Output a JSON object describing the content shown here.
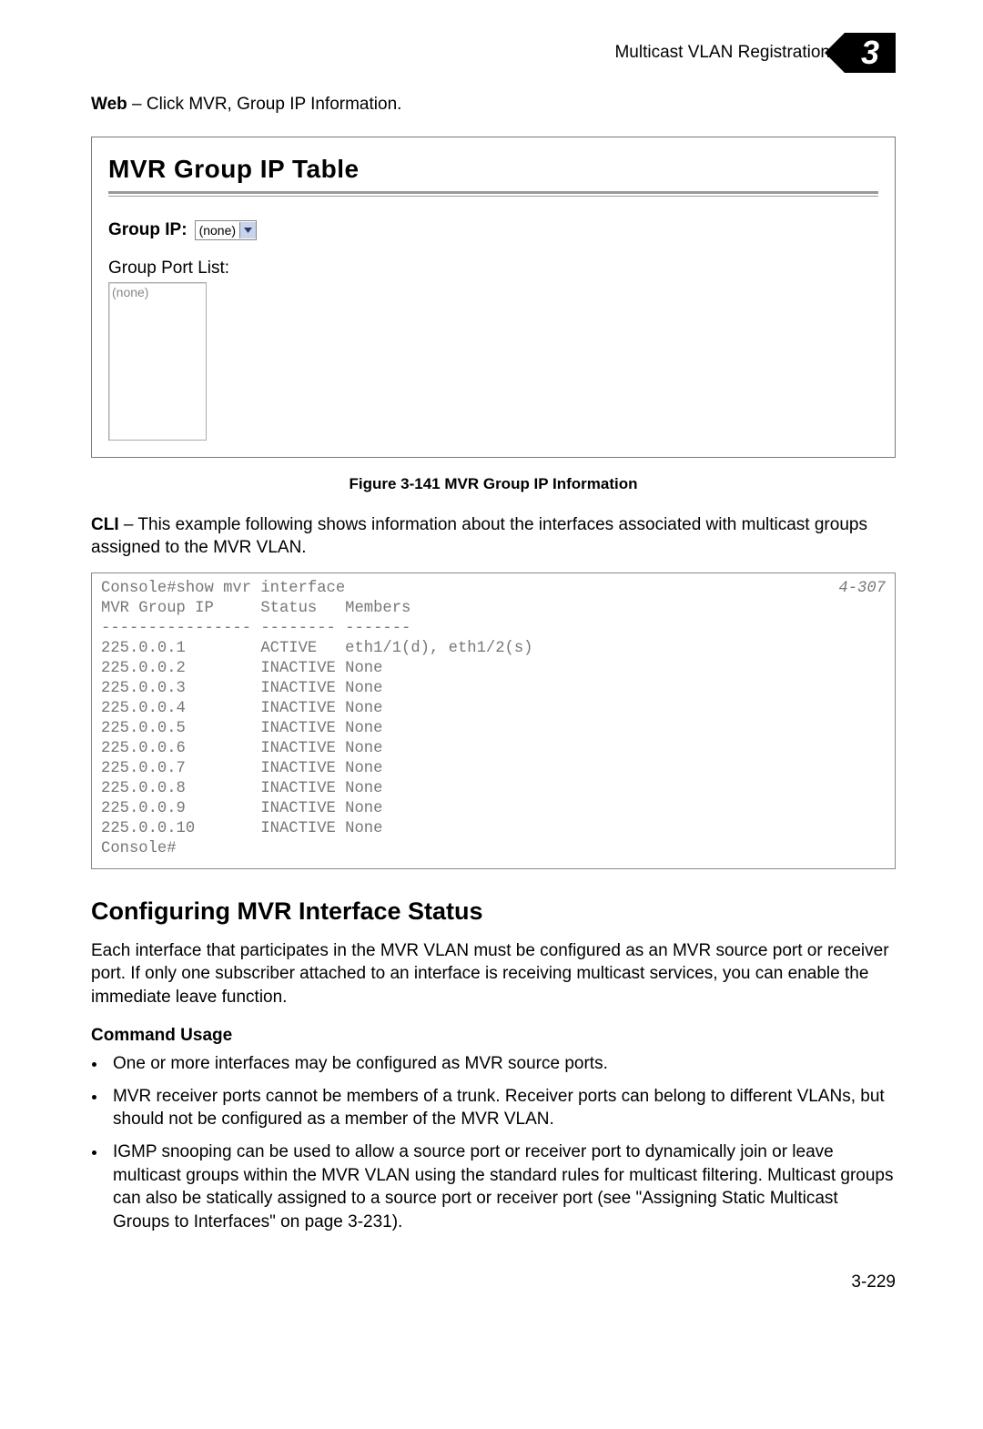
{
  "header": {
    "running_title": "Multicast VLAN Registration",
    "chapter_number": "3"
  },
  "nav": {
    "web_label": "Web",
    "web_desc": " – Click MVR, Group IP Information."
  },
  "panel": {
    "title": "MVR Group IP Table",
    "group_ip_label": "Group IP:",
    "group_ip_value": "(none)",
    "port_list_label": "Group Port List:",
    "port_list_value": "(none)"
  },
  "figure_caption": "Figure 3-141  MVR Group IP Information",
  "cli_intro": {
    "bold": "CLI",
    "rest": " – This example following shows information about the interfaces associated with multicast groups assigned to the MVR VLAN."
  },
  "cli": {
    "ref": "4-307",
    "command": "Console#show mvr interface",
    "header": "MVR Group IP     Status   Members",
    "divider": "---------------- -------- -------",
    "rows": [
      "225.0.0.1        ACTIVE   eth1/1(d), eth1/2(s)",
      "225.0.0.2        INACTIVE None",
      "225.0.0.3        INACTIVE None",
      "225.0.0.4        INACTIVE None",
      "225.0.0.5        INACTIVE None",
      "225.0.0.6        INACTIVE None",
      "225.0.0.7        INACTIVE None",
      "225.0.0.8        INACTIVE None",
      "225.0.0.9        INACTIVE None",
      "225.0.0.10       INACTIVE None"
    ],
    "prompt": "Console#"
  },
  "section": {
    "title": "Configuring MVR Interface Status",
    "para": "Each interface that participates in the MVR VLAN must be configured as an MVR source port or receiver port. If only one subscriber attached to an interface is receiving multicast services, you can enable the immediate leave function.",
    "usage_title": "Command Usage",
    "bullets": [
      "One or more interfaces may be configured as MVR source ports.",
      "MVR receiver ports cannot be members of a trunk. Receiver ports can belong to different VLANs, but should not be configured as a member of the MVR VLAN.",
      "IGMP snooping can be used to allow a source port or receiver port to dynamically join or leave multicast groups within the MVR VLAN using the standard rules for multicast filtering. Multicast groups can also be statically assigned to a source port or receiver port (see \"Assigning Static Multicast Groups to Interfaces\" on page 3-231)."
    ]
  },
  "page_number": "3-229"
}
